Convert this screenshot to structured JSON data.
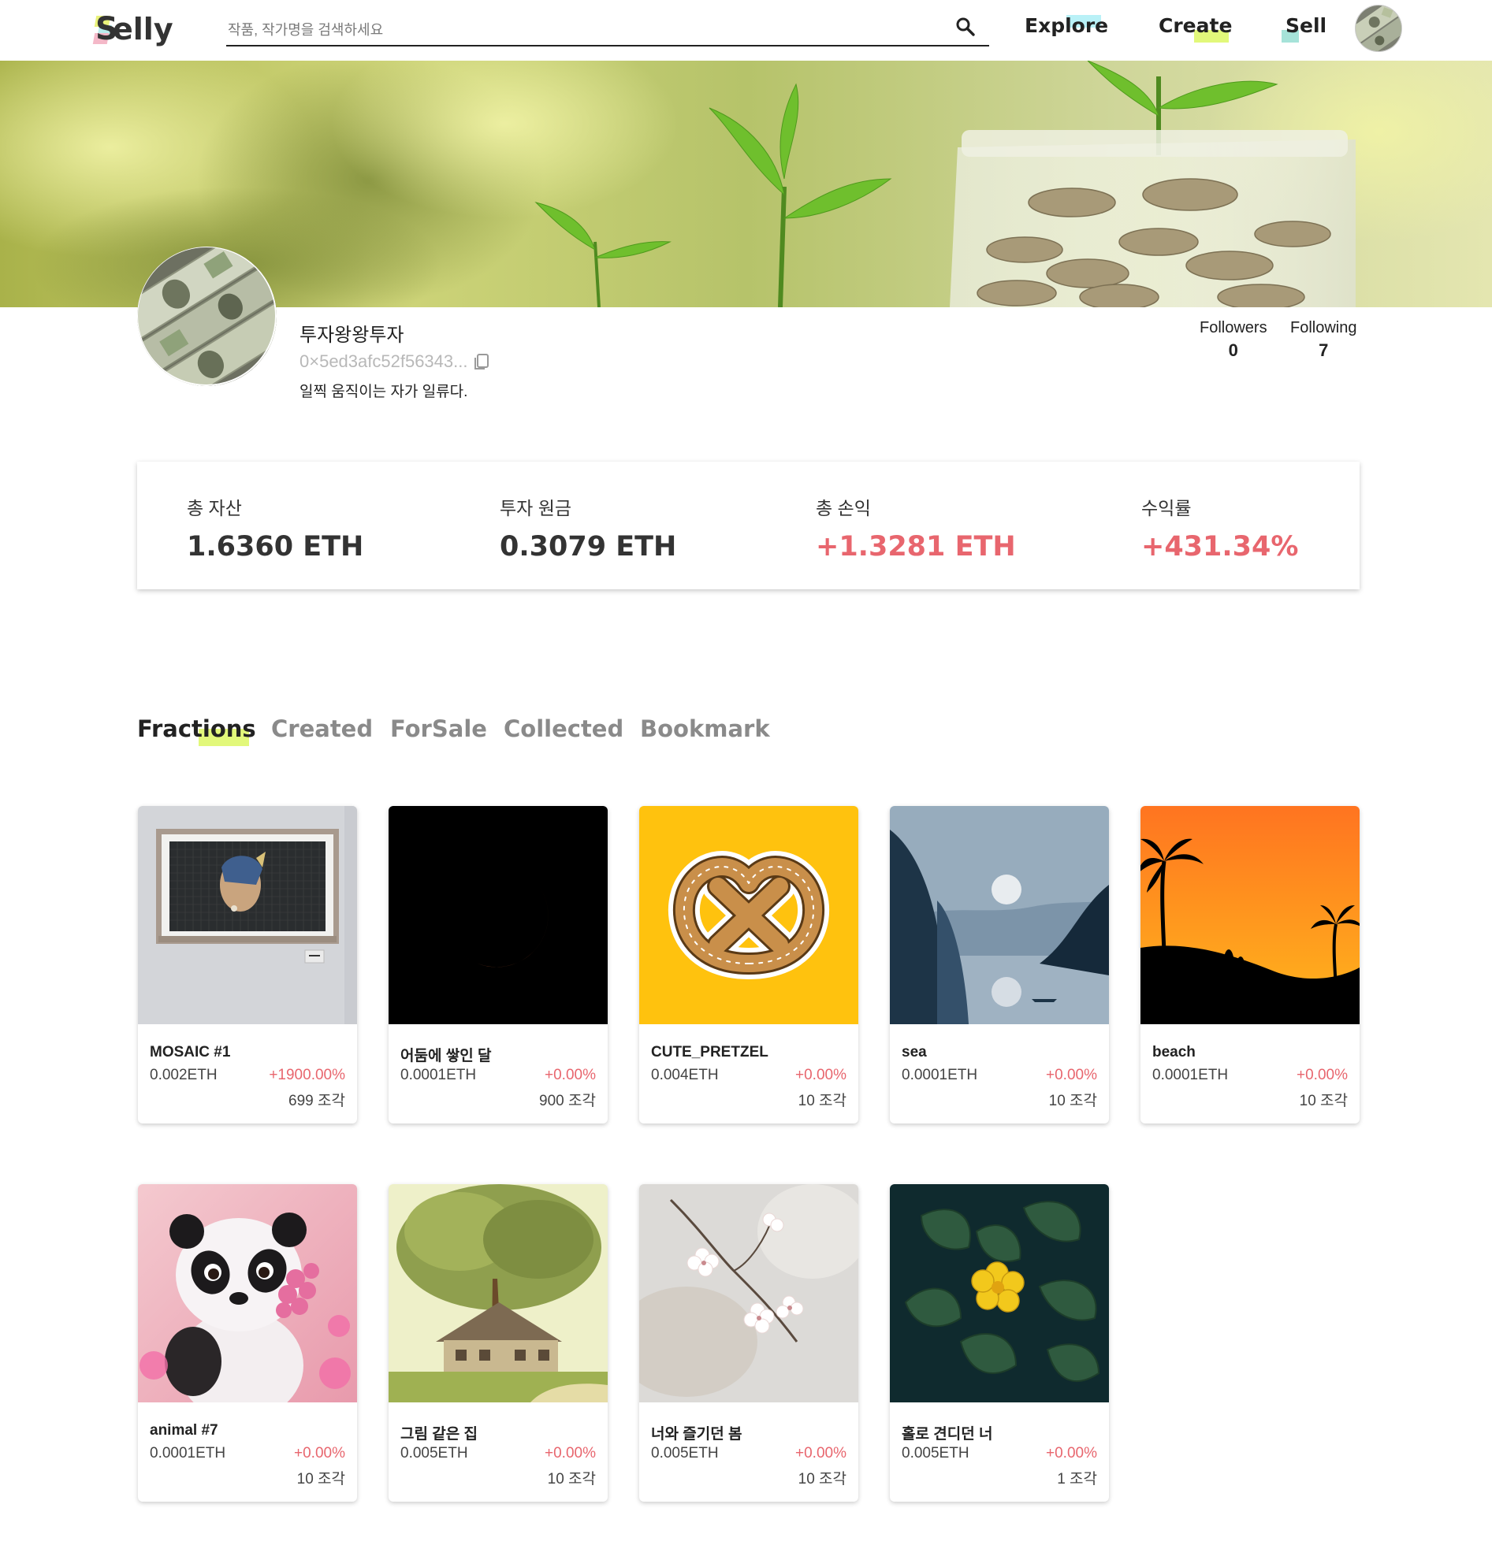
{
  "app": {
    "logo": "elly",
    "logo_initial": "S"
  },
  "search": {
    "placeholder": "작품, 작가명을 검색하세요",
    "value": ""
  },
  "nav": {
    "explore": "Explore",
    "create": "Create",
    "sell": "Sell"
  },
  "profile": {
    "username": "투자왕왕투자",
    "wallet": "0×5ed3afc52f56343...",
    "bio": "일찍 움직이는 자가 일류다.",
    "followers_label": "Followers",
    "followers": "0",
    "following_label": "Following",
    "following": "7"
  },
  "stats": {
    "total_assets": {
      "label": "총 자산",
      "value": "1.6360 ETH"
    },
    "principal": {
      "label": "투자 원금",
      "value": "0.3079 ETH"
    },
    "total_pnl": {
      "label": "총 손익",
      "value": "+1.3281 ETH"
    },
    "return_rate": {
      "label": "수익률",
      "value": "+431.34%"
    }
  },
  "tabs": [
    "Fractions",
    "Created",
    "ForSale",
    "Collected",
    "Bookmark"
  ],
  "active_tab": "Fractions",
  "cards": [
    {
      "title": "MOSAIC #1",
      "price": "0.002ETH",
      "rate": "+1900.00%",
      "pieces": "699 조각",
      "image": "mosaic-pearl-earring"
    },
    {
      "title": "어둠에 쌓인 달",
      "price": "0.0001ETH",
      "rate": "+0.00%",
      "pieces": "900 조각",
      "image": "red-crescent-moon"
    },
    {
      "title": "CUTE_PRETZEL",
      "price": "0.004ETH",
      "rate": "+0.00%",
      "pieces": "10 조각",
      "image": "pretzel"
    },
    {
      "title": "sea",
      "price": "0.0001ETH",
      "rate": "+0.00%",
      "pieces": "10 조각",
      "image": "fjord-landscape"
    },
    {
      "title": "beach",
      "price": "0.0001ETH",
      "rate": "+0.00%",
      "pieces": "10 조각",
      "image": "sunset-palms"
    },
    {
      "title": "animal #7",
      "price": "0.0001ETH",
      "rate": "+0.00%",
      "pieces": "10 조각",
      "image": "panda-flowers"
    },
    {
      "title": "그림 같은 집",
      "price": "0.005ETH",
      "rate": "+0.00%",
      "pieces": "10 조각",
      "image": "house-tree-painting"
    },
    {
      "title": "너와 즐기던 봄",
      "price": "0.005ETH",
      "rate": "+0.00%",
      "pieces": "10 조각",
      "image": "cherry-blossoms"
    },
    {
      "title": "홀로 견디던 너",
      "price": "0.005ETH",
      "rate": "+0.00%",
      "pieces": "1 조각",
      "image": "yellow-flower"
    }
  ],
  "colors": {
    "positive": "#e8666e",
    "highlight_green": "#e2f87a",
    "highlight_cyan": "#b9f1f7",
    "highlight_teal": "#a6e3d9"
  }
}
